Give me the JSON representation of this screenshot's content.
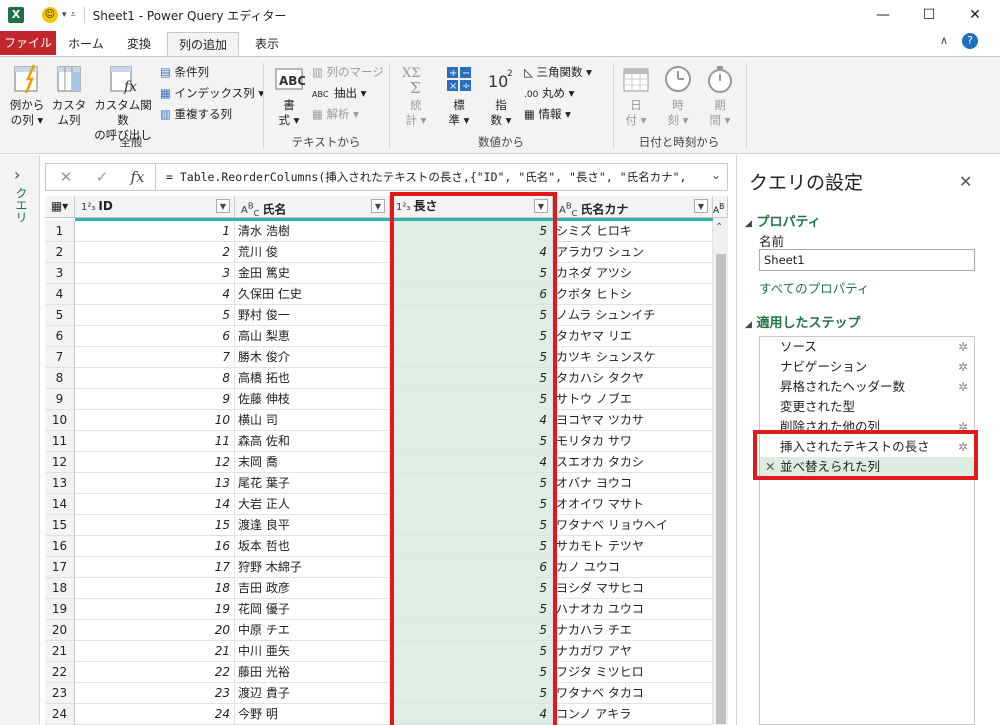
{
  "titlebar": {
    "title": "Sheet1 - Power Query エディター",
    "app_icon": "X",
    "minimize": "—",
    "maximize": "☐",
    "close": "✕"
  },
  "tabs": [
    "ファイル",
    "ホーム",
    "変換",
    "列の追加",
    "表示"
  ],
  "ribbon": {
    "general": {
      "example_col": [
        "例から",
        "の列 ▾"
      ],
      "custom_col": [
        "カスタ",
        "ム列"
      ],
      "invoke_custom": [
        "カスタム関数",
        "の呼び出し"
      ],
      "conditional": "条件列",
      "index": "インデックス列 ▾",
      "duplicate": "重複する列",
      "group": "全般"
    },
    "text": {
      "format": [
        "書",
        "式 ▾"
      ],
      "merge": "列のマージ",
      "extract": "抽出 ▾",
      "parse": "解析 ▾",
      "group": "テキストから"
    },
    "number": {
      "stats": [
        "統",
        "計 ▾"
      ],
      "standard": [
        "標",
        "準 ▾"
      ],
      "scientific": [
        "指",
        "数 ▾"
      ],
      "trig": "三角関数 ▾",
      "round": "丸め ▾",
      "info": "情報 ▾",
      "group": "数値から"
    },
    "datetime": {
      "date": [
        "日",
        "付 ▾"
      ],
      "time": [
        "時",
        "刻 ▾"
      ],
      "duration": [
        "期",
        "間 ▾"
      ],
      "group": "日付と時刻から"
    }
  },
  "left_pane": {
    "label": "クエリ",
    "chevron": "›"
  },
  "formula": {
    "text": "= Table.ReorderColumns(挿入されたテキストの長さ,{\"ID\", \"氏名\", \"長さ\", \"氏名カナ\","
  },
  "columns": [
    {
      "type": "1²₃",
      "name": "ID"
    },
    {
      "type": "A^B_C",
      "name": "氏名"
    },
    {
      "type": "1²₃",
      "name": "長さ"
    },
    {
      "type": "A^B_C",
      "name": "氏名カナ"
    }
  ],
  "rows": [
    [
      "1",
      "清水 浩樹",
      "5",
      "シミズ ヒロキ"
    ],
    [
      "2",
      "荒川 俊",
      "4",
      "アラカワ シュン"
    ],
    [
      "3",
      "金田 篤史",
      "5",
      "カネダ アツシ"
    ],
    [
      "4",
      "久保田 仁史",
      "6",
      "クボタ ヒトシ"
    ],
    [
      "5",
      "野村 俊一",
      "5",
      "ノムラ シュンイチ"
    ],
    [
      "6",
      "高山 梨恵",
      "5",
      "タカヤマ リエ"
    ],
    [
      "7",
      "勝木 俊介",
      "5",
      "カツキ シュンスケ"
    ],
    [
      "8",
      "高橋 拓也",
      "5",
      "タカハシ タクヤ"
    ],
    [
      "9",
      "佐藤 伸枝",
      "5",
      "サトウ ノブエ"
    ],
    [
      "10",
      "横山 司",
      "4",
      "ヨコヤマ ツカサ"
    ],
    [
      "11",
      "森高 佐和",
      "5",
      "モリタカ サワ"
    ],
    [
      "12",
      "末岡 喬",
      "4",
      "スエオカ タカシ"
    ],
    [
      "13",
      "尾花 葉子",
      "5",
      "オバナ ヨウコ"
    ],
    [
      "14",
      "大岩 正人",
      "5",
      "オオイワ マサト"
    ],
    [
      "15",
      "渡逢 良平",
      "5",
      "ワタナベ リョウヘイ"
    ],
    [
      "16",
      "坂本 哲也",
      "5",
      "サカモト テツヤ"
    ],
    [
      "17",
      "狩野 木綿子",
      "6",
      "カノ ユウコ"
    ],
    [
      "18",
      "吉田 政彦",
      "5",
      "ヨシダ マサヒコ"
    ],
    [
      "19",
      "花岡 優子",
      "5",
      "ハナオカ ユウコ"
    ],
    [
      "20",
      "中原 チエ",
      "5",
      "ナカハラ チエ"
    ],
    [
      "21",
      "中川 亜矢",
      "5",
      "ナカガワ アヤ"
    ],
    [
      "22",
      "藤田 光裕",
      "5",
      "フジタ ミツヒロ"
    ],
    [
      "23",
      "渡辺 貴子",
      "5",
      "ワタナベ タカコ"
    ],
    [
      "24",
      "今野 明",
      "4",
      "コンノ アキラ"
    ]
  ],
  "settings": {
    "title": "クエリの設定",
    "close": "✕",
    "properties": "プロパティ",
    "name_label": "名前",
    "name_value": "Sheet1",
    "all_props": "すべてのプロパティ",
    "applied_steps": "適用したステップ",
    "steps": [
      "ソース",
      "ナビゲーション",
      "昇格されたヘッダー数",
      "変更された型",
      "削除された他の列",
      "挿入されたテキストの長さ",
      "並べ替えられた列"
    ]
  }
}
